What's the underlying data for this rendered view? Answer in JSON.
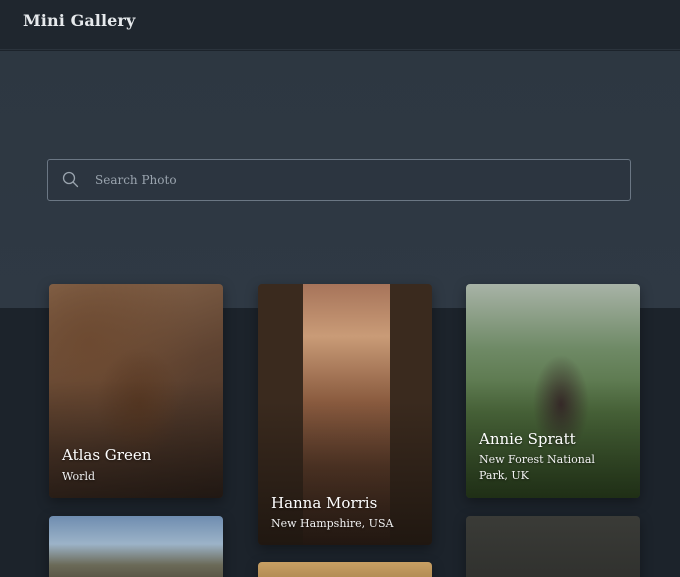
{
  "app": {
    "title": "Mini Gallery"
  },
  "search": {
    "placeholder": "Search Photo",
    "value": ""
  },
  "photos": [
    {
      "author": "Atlas Green",
      "location": "World"
    },
    {
      "author": "Hanna Morris",
      "location": "New Hampshire, USA"
    },
    {
      "author": "Annie Spratt",
      "location": "New Forest National Park, UK"
    }
  ]
}
